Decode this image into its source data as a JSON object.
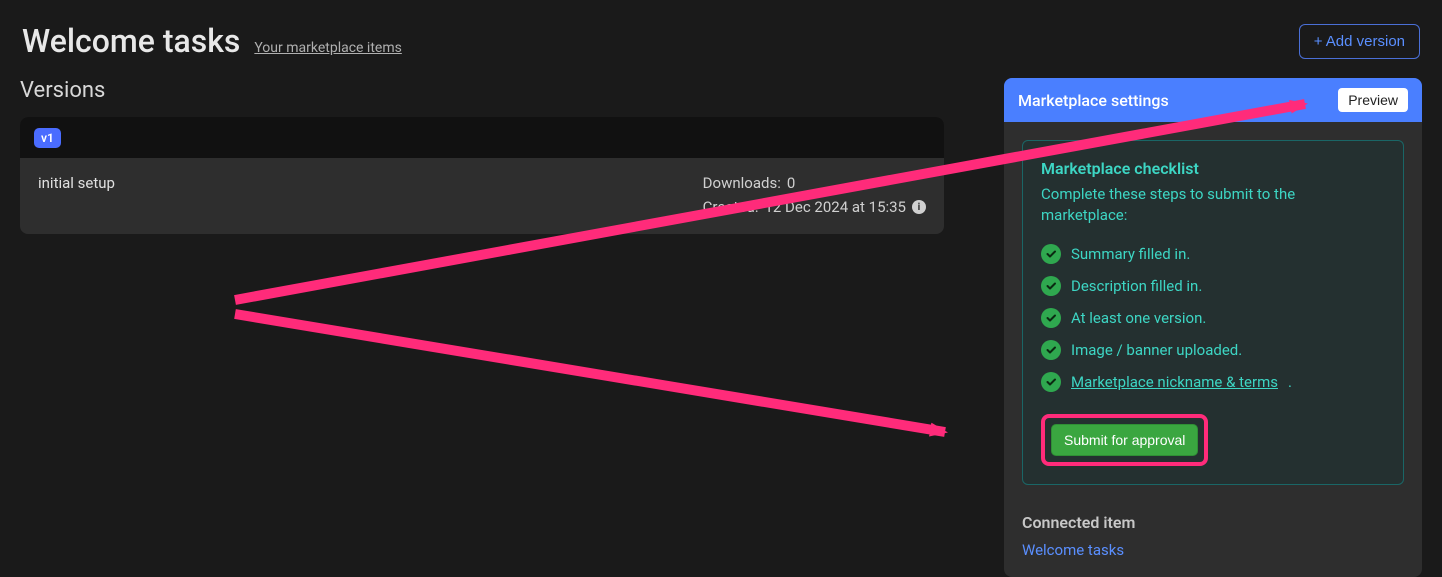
{
  "header": {
    "title": "Welcome tasks",
    "breadcrumb": "Your marketplace items",
    "add_version_label": "+ Add version"
  },
  "versions": {
    "heading": "Versions",
    "items": [
      {
        "badge": "v1",
        "name": "initial setup",
        "downloads_label": "Downloads:",
        "downloads_value": "0",
        "created_label": "Created:",
        "created_value": "12 Dec 2024 at 15:35"
      }
    ]
  },
  "panel": {
    "title": "Marketplace settings",
    "preview_label": "Preview",
    "checklist": {
      "heading": "Marketplace checklist",
      "sub": "Complete these steps to submit to the marketplace:",
      "items": [
        {
          "label": "Summary filled in.",
          "done": true,
          "link": false
        },
        {
          "label": "Description filled in.",
          "done": true,
          "link": false
        },
        {
          "label": "At least one version.",
          "done": true,
          "link": false
        },
        {
          "label": "Image / banner uploaded.",
          "done": true,
          "link": false
        },
        {
          "label": "Marketplace nickname & terms",
          "done": true,
          "link": true,
          "trailing": "."
        }
      ],
      "submit_label": "Submit for approval"
    },
    "connected": {
      "heading": "Connected item",
      "link_label": "Welcome tasks"
    }
  }
}
